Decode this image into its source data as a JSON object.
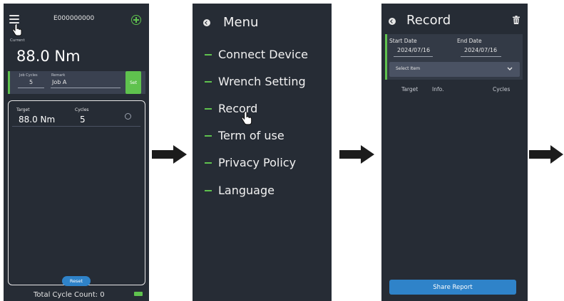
{
  "screen1": {
    "device_id": "E000000000",
    "current_label": "Current",
    "current_value": "88.0 Nm",
    "job_cycles_label": "Job Cycles",
    "job_cycles_value": "5",
    "remark_label": "Remark",
    "remark_value": "Job A",
    "set_button": "Set",
    "target_label": "Target",
    "target_value": "88.0 Nm",
    "cycles_label": "Cycles",
    "cycles_value": "5",
    "reset_button": "Reset",
    "total_cycle_count": "Total Cycle Count: 0"
  },
  "screen2": {
    "title": "Menu",
    "items": [
      "Connect Device",
      "Wrench Setting",
      "Record",
      "Term of use",
      "Privacy Policy",
      "Language"
    ]
  },
  "screen3": {
    "title": "Record",
    "start_date_label": "Start Date",
    "start_date_value": "2024/07/16",
    "end_date_label": "End Date",
    "end_date_value": "2024/07/16",
    "select_placeholder": "Select Item",
    "col_target": "Target",
    "col_info": "Info.",
    "col_cycles": "Cycles",
    "share_button": "Share Report"
  },
  "colors": {
    "background": "#262c35",
    "accent_green": "#5fc24e",
    "button_blue": "#2f83c9"
  }
}
